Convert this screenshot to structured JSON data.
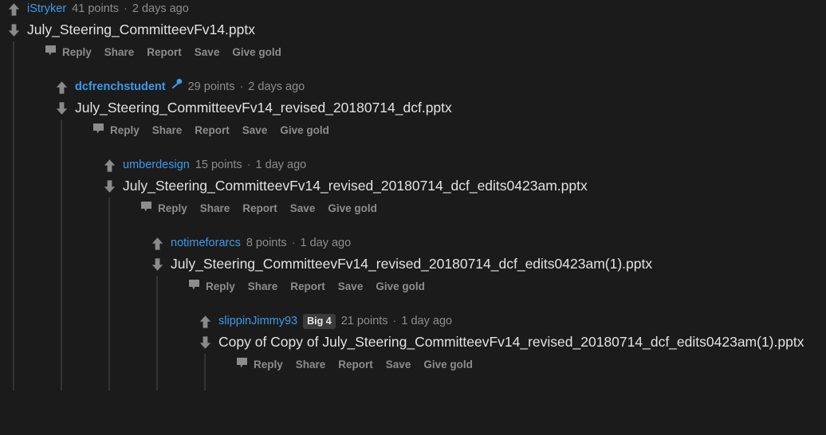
{
  "theme": {
    "background": "#1b1b1b",
    "link_blue": "#3d9ae8",
    "meta_gray": "#8d8d8d",
    "body_text": "#e2e2e2",
    "threadline": "#343434",
    "arrow_gray": "#8a8a8a",
    "flair_bg": "#3b3b3b"
  },
  "actions": {
    "reply": "Reply",
    "share": "Share",
    "report": "Report",
    "save": "Save",
    "give_gold": "Give gold",
    "reply_icon": "speech-bubble-icon",
    "upvote_icon": "upvote-arrow-icon",
    "downvote_icon": "downvote-arrow-icon"
  },
  "separator": "·",
  "comments": [
    {
      "author": "iStryker",
      "author_bold": false,
      "flair": null,
      "icon": null,
      "points": "41 points",
      "age": "2 days ago",
      "body": "July_Steering_CommitteevFv14.pptx"
    },
    {
      "author": "dcfrenchstudent",
      "author_bold": true,
      "flair": null,
      "icon": "microphone-icon",
      "points": "29 points",
      "age": "2 days ago",
      "body": "July_Steering_CommitteevFv14_revised_20180714_dcf.pptx"
    },
    {
      "author": "umberdesign",
      "author_bold": false,
      "flair": null,
      "icon": null,
      "points": "15 points",
      "age": "1 day ago",
      "body": "July_Steering_CommitteevFv14_revised_20180714_dcf_edits0423am.pptx"
    },
    {
      "author": "notimeforarcs",
      "author_bold": false,
      "flair": null,
      "icon": null,
      "points": "8 points",
      "age": "1 day ago",
      "body": "July_Steering_CommitteevFv14_revised_20180714_dcf_edits0423am(1).pptx"
    },
    {
      "author": "slippinJimmy93",
      "author_bold": false,
      "flair": "Big 4",
      "icon": null,
      "points": "21 points",
      "age": "1 day ago",
      "body": "Copy of Copy of July_Steering_CommitteevFv14_revised_20180714_dcf_edits0423am(1).pptx"
    }
  ]
}
